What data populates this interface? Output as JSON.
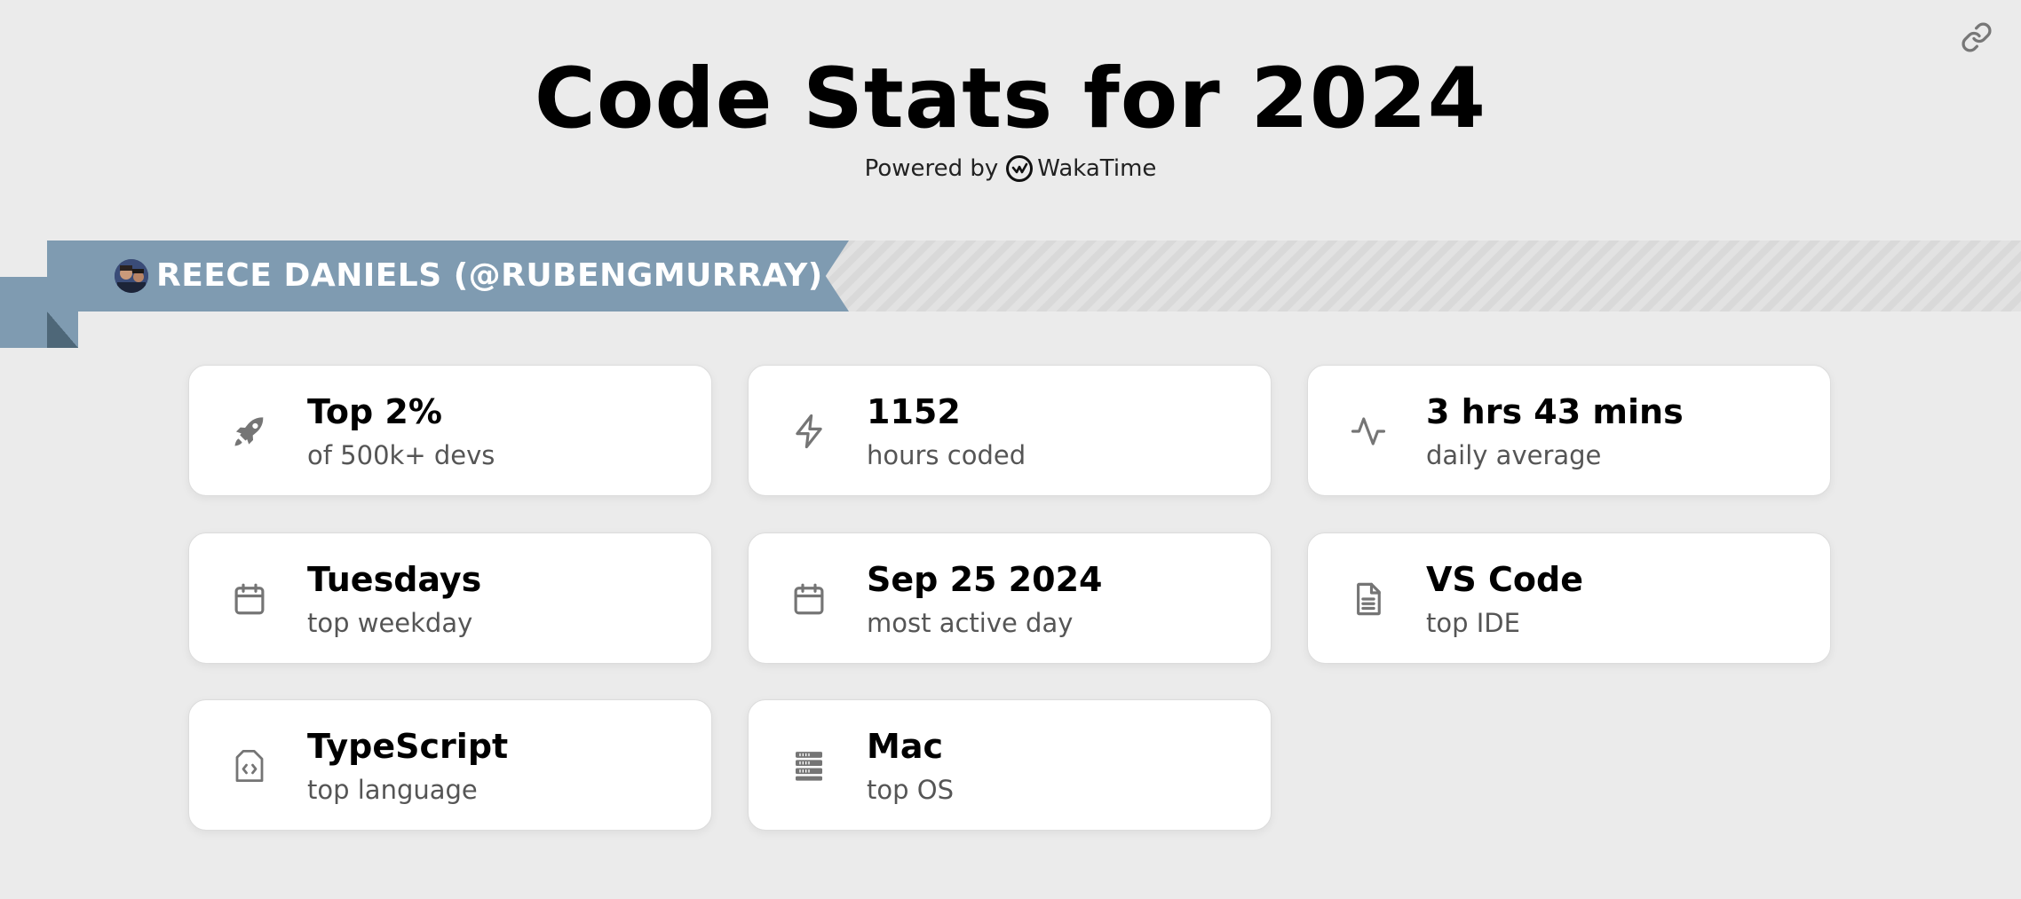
{
  "header": {
    "title": "Code Stats for 2024",
    "powered_by": "Powered by",
    "brand": "WakaTime",
    "share_icon": "link-icon"
  },
  "user": {
    "name": "REECE DANIELS (@RUBENGMURRAY)",
    "avatar_icon": "avatar"
  },
  "colors": {
    "background": "#ebebeb",
    "ribbon": "#7f9bb1",
    "ribbon_fold": "#4e6778",
    "card": "#ffffff",
    "icon": "#757575",
    "label": "#555555"
  },
  "stats": [
    {
      "icon": "rocket-icon",
      "value": "Top 2%",
      "label": "of 500k+ devs"
    },
    {
      "icon": "lightning-icon",
      "value": "1152",
      "label": "hours coded"
    },
    {
      "icon": "activity-icon",
      "value": "3 hrs 43 mins",
      "label": "daily average"
    },
    {
      "icon": "calendar-icon",
      "value": "Tuesdays",
      "label": "top weekday"
    },
    {
      "icon": "calendar-icon",
      "value": "Sep 25 2024",
      "label": "most active day"
    },
    {
      "icon": "document-icon",
      "value": "VS Code",
      "label": "top IDE"
    },
    {
      "icon": "code-file-icon",
      "value": "TypeScript",
      "label": "top language"
    },
    {
      "icon": "server-icon",
      "value": "Mac",
      "label": "top OS"
    }
  ]
}
